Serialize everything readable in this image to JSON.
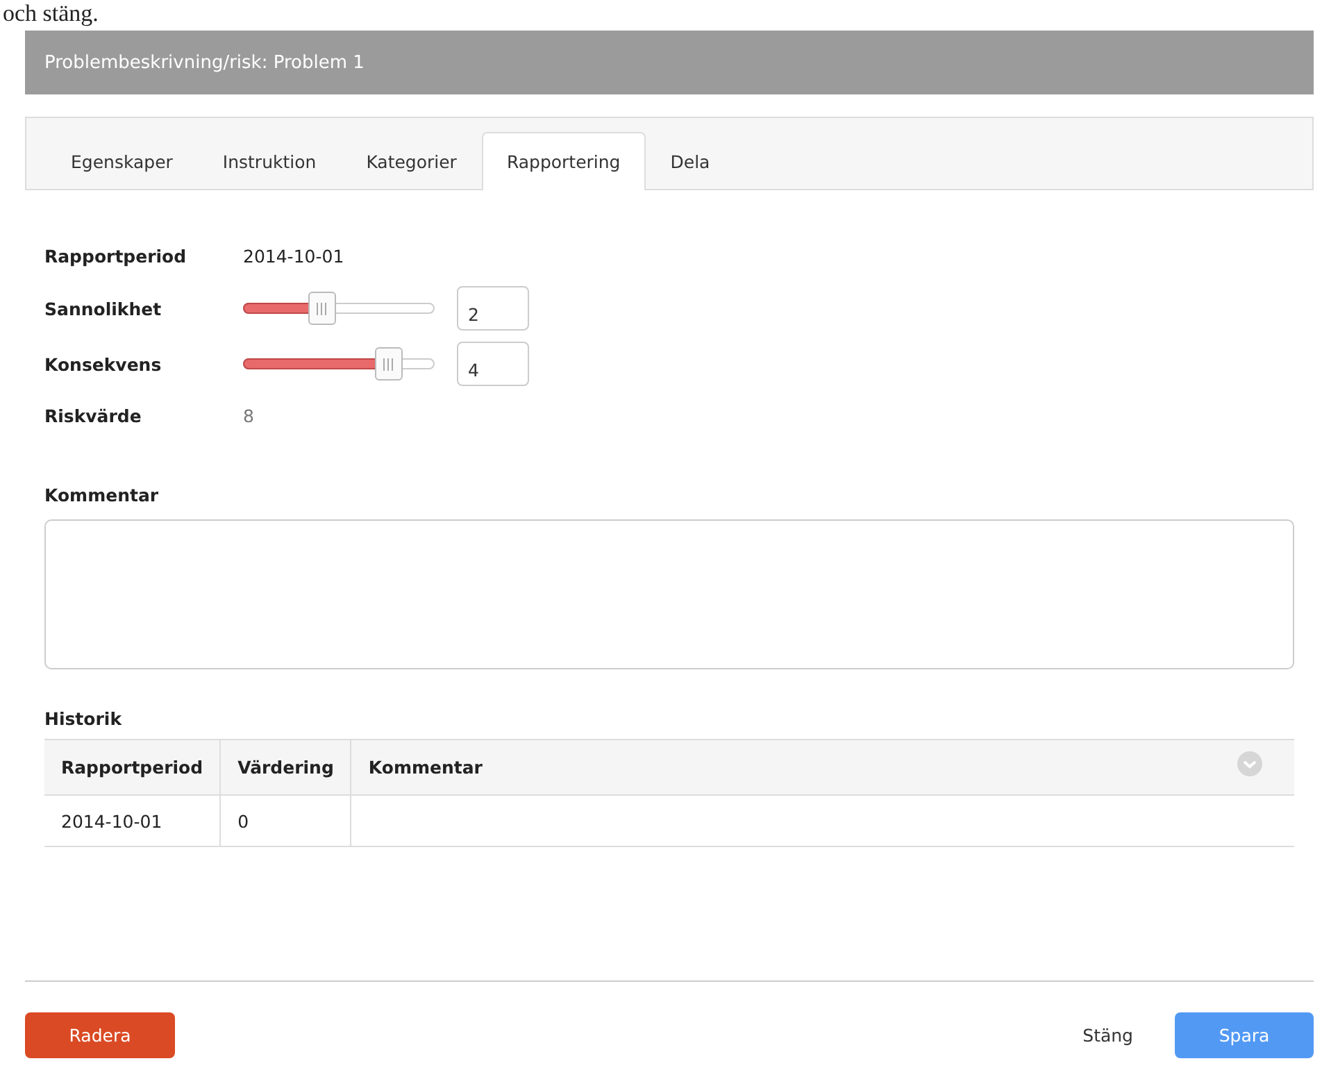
{
  "above_text": "och stäng.",
  "window": {
    "title": "Problembeskrivning/risk: Problem 1"
  },
  "tabs": [
    {
      "label": "Egenskaper",
      "selected": false
    },
    {
      "label": "Instruktion",
      "selected": false
    },
    {
      "label": "Kategorier",
      "selected": false
    },
    {
      "label": "Rapportering",
      "selected": true
    },
    {
      "label": "Dela",
      "selected": false
    }
  ],
  "fields": [
    {
      "kind": "text",
      "label": "Rapportperiod",
      "value": "2014-10-01"
    },
    {
      "kind": "slider",
      "label": "Sannolikhet",
      "level": 0.41,
      "value": "2"
    },
    {
      "kind": "slider",
      "label": "Konsekvens",
      "level": 0.76,
      "value": "4"
    },
    {
      "kind": "muted",
      "label": "Riskvärde",
      "value": "8"
    }
  ],
  "comment": {
    "label": "Kommentar"
  },
  "history": {
    "title": "Historik",
    "columns": [
      "Rapportperiod",
      "Värdering",
      "Kommentar"
    ],
    "rows": [
      [
        "2014-10-01",
        "0",
        ""
      ]
    ]
  },
  "buttons": {
    "delete": "Radera",
    "close": "Stäng",
    "save": "Spara"
  }
}
